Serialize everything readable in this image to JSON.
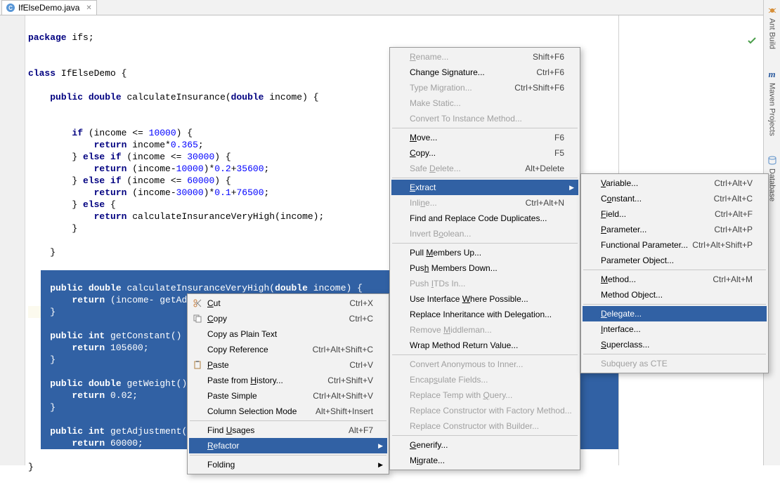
{
  "tab": {
    "name": "IfElseDemo.java"
  },
  "code": {
    "l1": "package ifs;",
    "l3": "class IfElseDemo {",
    "l5": "    public double calculateInsurance(double income) {",
    "l8": "        if (income <= 10000) {",
    "l9": "            return income*0.365;",
    "l10": "        } else if (income <= 30000) {",
    "l11": "            return (income-10000)*0.2+35600;",
    "l12": "        } else if (income <= 60000) {",
    "l13": "            return (income-30000)*0.1+76500;",
    "l14": "        } else {",
    "l15": "            return calculateInsuranceVeryHigh(income);",
    "l16": "        }",
    "l18": "    }",
    "s1": "    public double calculateInsuranceVeryHigh(double income) {",
    "s2": "        return (income- getAdjustment())* getWeight() + getConstant();",
    "s3": "    }",
    "s5": "    public int getConstant() {",
    "s6": "        return 105600;",
    "s7": "    }",
    "s9": "    public double getWeight() {",
    "s10": "        return 0.02;",
    "s11": "    }",
    "s13": "    public int getAdjustment() {",
    "s14": "        return 60000;",
    "s15": "    }",
    "end": "}"
  },
  "menu1": {
    "cut": "Cut",
    "cut_k": "Ctrl+X",
    "copy": "Copy",
    "copy_k": "Ctrl+C",
    "copy_plain": "Copy as Plain Text",
    "copy_ref": "Copy Reference",
    "copy_ref_k": "Ctrl+Alt+Shift+C",
    "paste": "Paste",
    "paste_k": "Ctrl+V",
    "paste_hist": "Paste from History...",
    "paste_hist_k": "Ctrl+Shift+V",
    "paste_simple": "Paste Simple",
    "paste_simple_k": "Ctrl+Alt+Shift+V",
    "col_sel": "Column Selection Mode",
    "col_sel_k": "Alt+Shift+Insert",
    "find_usages": "Find Usages",
    "find_usages_k": "Alt+F7",
    "refactor": "Refactor",
    "folding": "Folding"
  },
  "menu2": {
    "rename": "Rename...",
    "rename_k": "Shift+F6",
    "change_sig": "Change Signature...",
    "change_sig_k": "Ctrl+F6",
    "type_mig": "Type Migration...",
    "type_mig_k": "Ctrl+Shift+F6",
    "make_static": "Make Static...",
    "conv_inst": "Convert To Instance Method...",
    "move": "Move...",
    "move_k": "F6",
    "copy": "Copy...",
    "copy_k": "F5",
    "safe_del": "Safe Delete...",
    "safe_del_k": "Alt+Delete",
    "extract": "Extract",
    "inline": "Inline...",
    "inline_k": "Ctrl+Alt+N",
    "find_dup": "Find and Replace Code Duplicates...",
    "invert_bool": "Invert Boolean...",
    "pull_up": "Pull Members Up...",
    "push_down": "Push Members Down...",
    "push_itd": "Push ITDs In...",
    "use_iface": "Use Interface Where Possible...",
    "repl_inh": "Replace Inheritance with Delegation...",
    "rem_mid": "Remove Middleman...",
    "wrap_ret": "Wrap Method Return Value...",
    "conv_anon": "Convert Anonymous to Inner...",
    "encap": "Encapsulate Fields...",
    "repl_temp": "Replace Temp with Query...",
    "repl_fac": "Replace Constructor with Factory Method...",
    "repl_build": "Replace Constructor with Builder...",
    "generify": "Generify...",
    "migrate": "Migrate..."
  },
  "menu3": {
    "variable": "Variable...",
    "variable_k": "Ctrl+Alt+V",
    "constant": "Constant...",
    "constant_k": "Ctrl+Alt+C",
    "field": "Field...",
    "field_k": "Ctrl+Alt+F",
    "parameter": "Parameter...",
    "parameter_k": "Ctrl+Alt+P",
    "func_param": "Functional Parameter...",
    "func_param_k": "Ctrl+Alt+Shift+P",
    "param_obj": "Parameter Object...",
    "method": "Method...",
    "method_k": "Ctrl+Alt+M",
    "method_obj": "Method Object...",
    "delegate": "Delegate...",
    "interface": "Interface...",
    "superclass": "Superclass...",
    "subquery": "Subquery as CTE"
  },
  "rail": {
    "ant": "Ant Build",
    "maven": "Maven Projects",
    "db": "Database"
  }
}
